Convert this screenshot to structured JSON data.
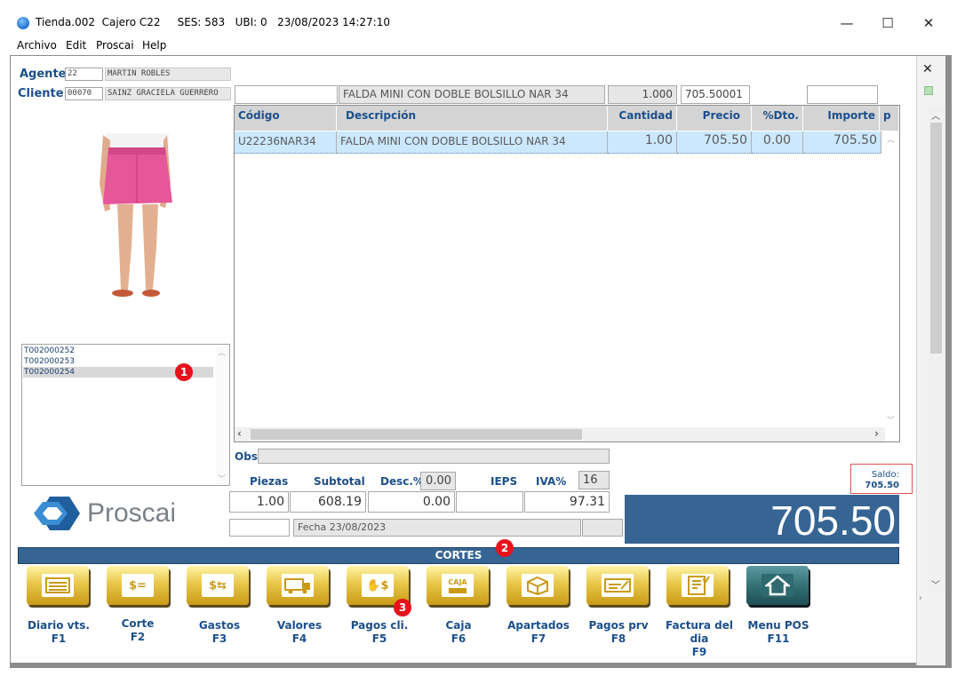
{
  "window": {
    "title": "Tienda.002  Cajero C22     SES: 583   UBI: 0   23/08/2023 14:27:10",
    "minimize": "—",
    "maximize": "☐",
    "close": "✕"
  },
  "menu": [
    "Archivo",
    "Edit",
    "Proscai",
    "Help"
  ],
  "side_panel": {
    "close": "✕"
  },
  "agent": {
    "label": "Agente",
    "code": "22",
    "name": "MARTIN ROBLES"
  },
  "client": {
    "label": "Cliente",
    "code": "00070",
    "name": "SAINZ GRACIELA GUERRERO"
  },
  "entry": {
    "code": "",
    "description": "FALDA MINI CON DOBLE BOLSILLO NAR 34",
    "quantity": "1.000",
    "price": "705.50001",
    "extra": ""
  },
  "grid": {
    "headers": [
      "Código",
      "Descripción",
      "Cantidad",
      "Precio",
      "%Dto.",
      "Importe",
      "p"
    ],
    "rows": [
      [
        "U22236NAR34",
        "FALDA MINI CON DOBLE BOLSILLO NAR 34",
        "1.00",
        "705.50",
        "0.00",
        "705.50"
      ]
    ]
  },
  "tickets": [
    "T002000252",
    "T002000253",
    "T002000254"
  ],
  "badges": [
    "1",
    "2",
    "3"
  ],
  "brand": {
    "name": "Proscai"
  },
  "obs": {
    "label": "Obs",
    "value": ""
  },
  "totals": {
    "labels": {
      "pieces": "Piezas",
      "subtotal": "Subtotal",
      "discount": "Desc.%",
      "ieps": "IEPS",
      "iva": "IVA%"
    },
    "discount_pct": "0.00",
    "iva_pct": "16",
    "pieces": "1.00",
    "subtotal": "608.19",
    "discount": "0.00",
    "ieps": "",
    "iva": "97.31",
    "date": "Fecha 23/08/2023",
    "total": "705.50"
  },
  "saldo": {
    "label": "Saldo:",
    "value": "705.50"
  },
  "cortes": {
    "title": "CORTES"
  },
  "functions": [
    {
      "label": "Diario vts.",
      "key": "F1",
      "icon": "ledger-icon"
    },
    {
      "label": "Corte",
      "key": "F2",
      "icon": "cash-bill-icon"
    },
    {
      "label": "Gastos",
      "key": "F3",
      "icon": "money-hand-icon"
    },
    {
      "label": "Valores",
      "key": "F4",
      "icon": "armored-truck-icon"
    },
    {
      "label": "Pagos cli.",
      "key": "F5",
      "icon": "payment-hand-icon"
    },
    {
      "label": "Caja",
      "key": "F6",
      "icon": "cash-register-icon"
    },
    {
      "label": "Apartados",
      "key": "F7",
      "icon": "package-icon"
    },
    {
      "label": "Pagos prv",
      "key": "F8",
      "icon": "cheque-icon"
    },
    {
      "label": "Factura del dia",
      "key": "F9",
      "icon": "invoice-icon"
    },
    {
      "label": "Menu POS",
      "key": "F11",
      "icon": "home-icon"
    }
  ],
  "function_icon_text": {
    "caja": "CAJA"
  },
  "colors": {
    "accent": "#366594",
    "label_blue": "#1b4f8c",
    "selected_row": "#cce8ff",
    "button_gold": "#e8c74a",
    "badge_red": "#e8121c"
  }
}
